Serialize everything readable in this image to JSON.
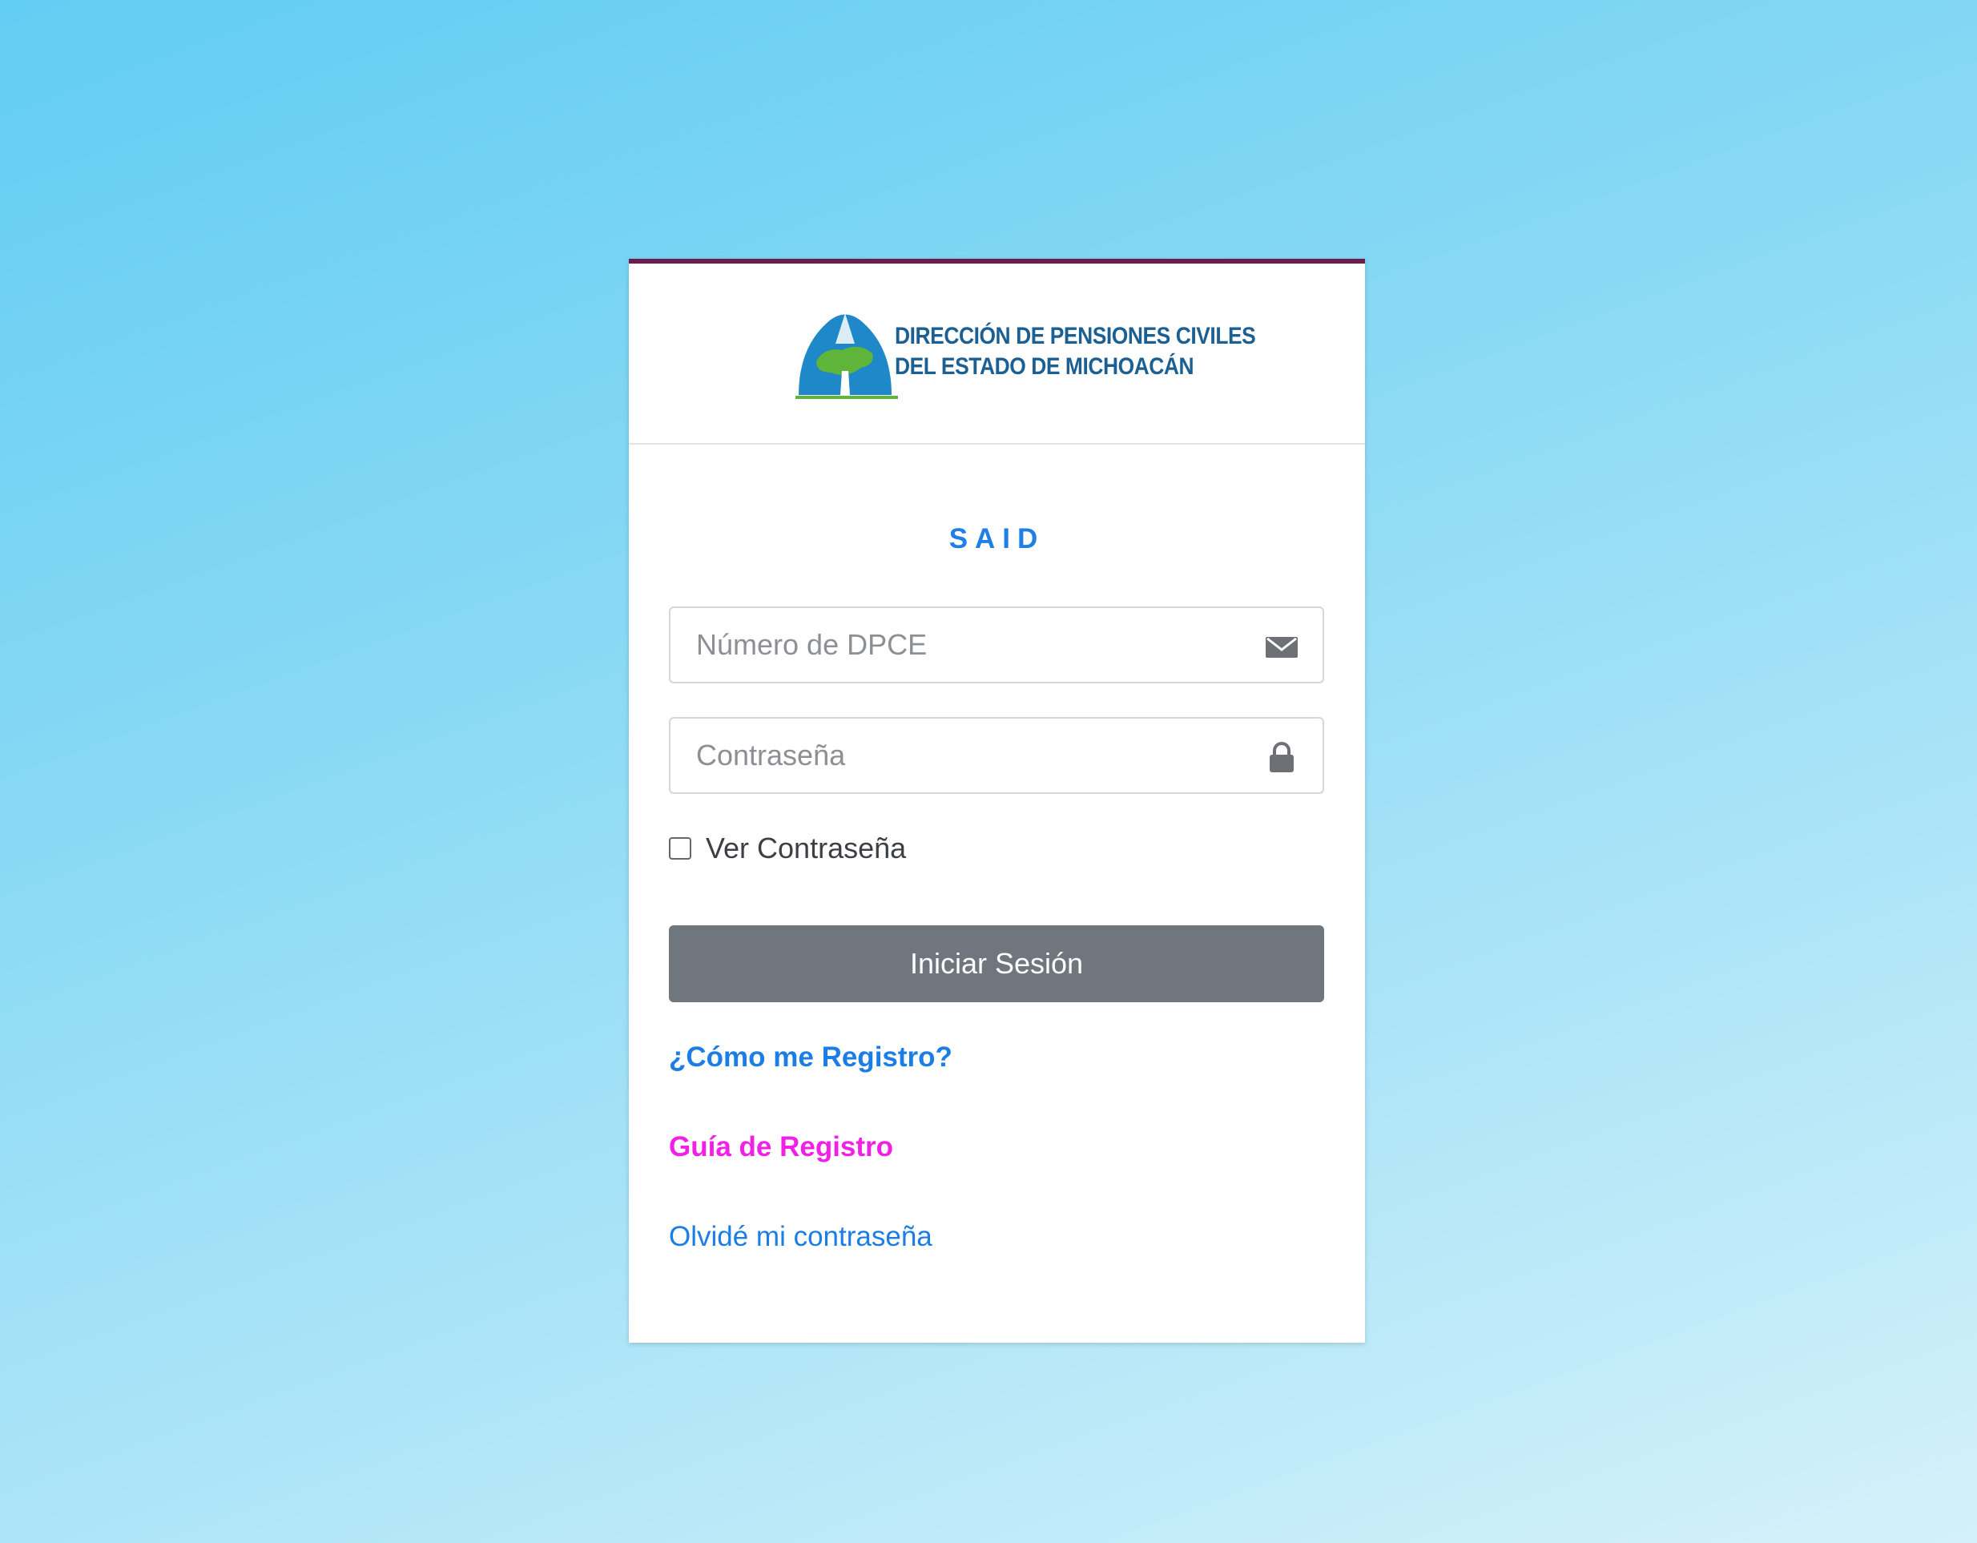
{
  "header": {
    "org_name_line1": "DIRECCIÓN DE PENSIONES CIVILES",
    "org_name_line2": "DEL ESTADO DE MICHOACÁN"
  },
  "title": "SAID",
  "fields": {
    "dpce": {
      "placeholder": "Número de DPCE",
      "value": "",
      "icon": "envelope-icon"
    },
    "password": {
      "placeholder": "Contraseña",
      "value": "",
      "icon": "lock-icon"
    }
  },
  "show_password": {
    "label": "Ver Contraseña",
    "checked": false
  },
  "login_button": {
    "label": "Iniciar Sesión"
  },
  "links": {
    "register": "¿Cómo me Registro?",
    "guide": "Guía de Registro",
    "forgot": "Olvidé mi contraseña"
  },
  "colors": {
    "accent_bar": "#6b1d4d",
    "link_blue": "#1a7ee6",
    "link_magenta": "#f21fe6",
    "button_gray": "#6f767e"
  }
}
